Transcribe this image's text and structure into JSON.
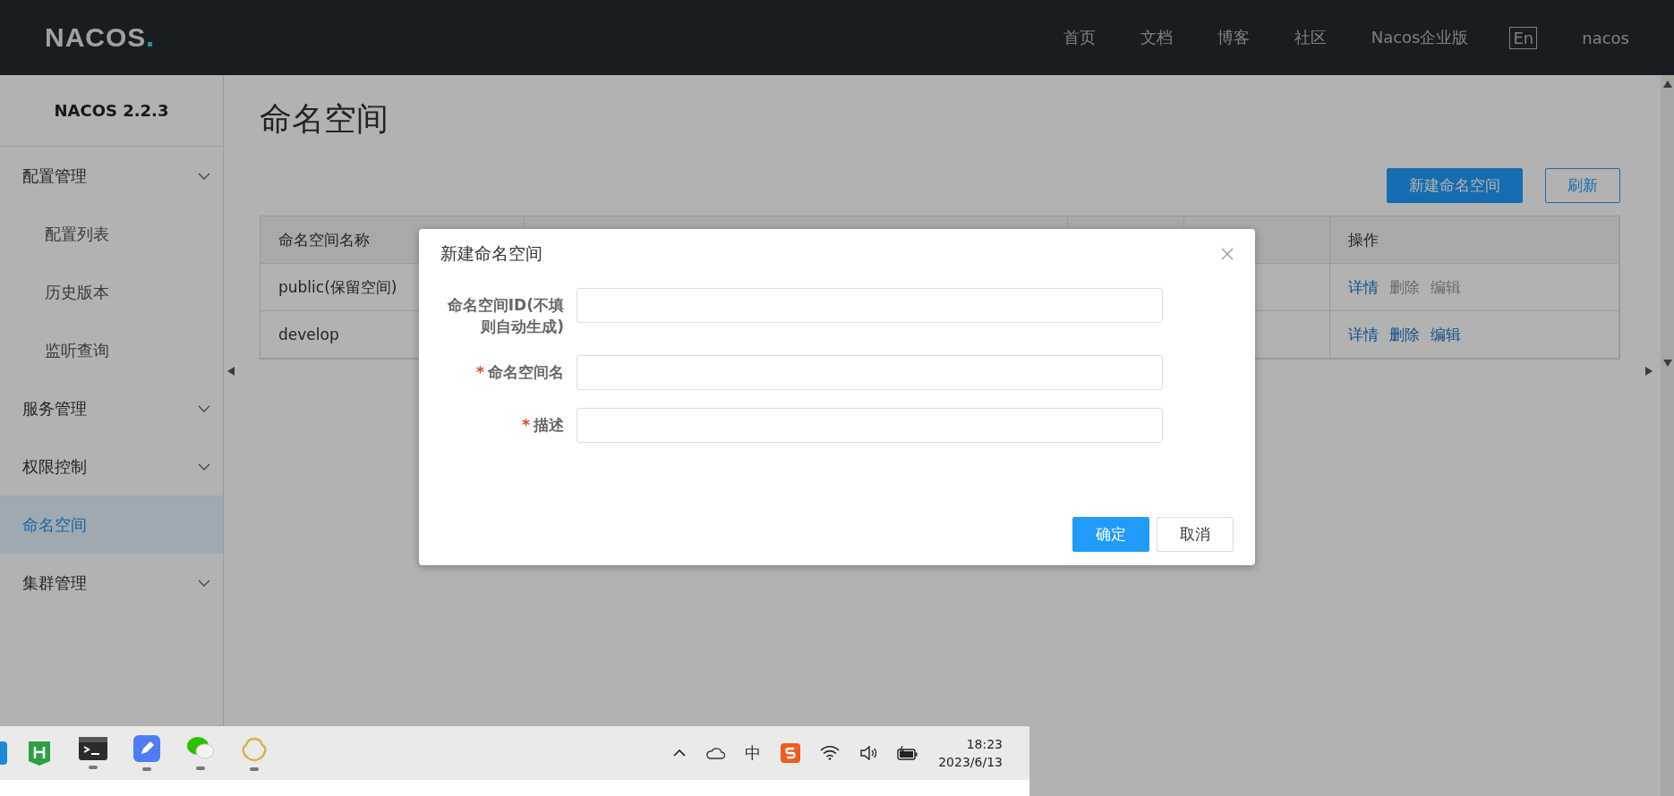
{
  "header": {
    "logo": "NACOS",
    "nav": [
      {
        "label": "首页",
        "kind": "link"
      },
      {
        "label": "文档",
        "kind": "link"
      },
      {
        "label": "博客",
        "kind": "link"
      },
      {
        "label": "社区",
        "kind": "link"
      },
      {
        "label": "Nacos企业版",
        "kind": "link"
      },
      {
        "label": "En",
        "kind": "boxed"
      },
      {
        "label": "nacos",
        "kind": "link"
      }
    ]
  },
  "sidebar": {
    "version": "NACOS 2.2.3",
    "items": [
      {
        "label": "配置管理",
        "kind": "group",
        "expanded": true,
        "selected": false,
        "children": [
          {
            "label": "配置列表",
            "selected": false
          },
          {
            "label": "历史版本",
            "selected": false
          },
          {
            "label": "监听查询",
            "selected": false
          }
        ]
      },
      {
        "label": "服务管理",
        "kind": "group",
        "selected": false
      },
      {
        "label": "权限控制",
        "kind": "group",
        "selected": false
      },
      {
        "label": "命名空间",
        "kind": "link",
        "selected": true
      },
      {
        "label": "集群管理",
        "kind": "group",
        "selected": false
      }
    ]
  },
  "page": {
    "title": "命名空间",
    "buttons": [
      {
        "label": "新建命名空间",
        "kind": "primary"
      },
      {
        "label": "刷新",
        "kind": "outline"
      }
    ]
  },
  "table": {
    "columns": [
      "命名空间名称",
      "操作"
    ],
    "rows": [
      {
        "name": "public(保留空间)",
        "actions": [
          {
            "label": "详情",
            "disabled": false
          },
          {
            "label": "删除",
            "disabled": true
          },
          {
            "label": "编辑",
            "disabled": true
          }
        ]
      },
      {
        "name": "develop",
        "actions": [
          {
            "label": "详情",
            "disabled": false
          },
          {
            "label": "删除",
            "disabled": false
          },
          {
            "label": "编辑",
            "disabled": false
          }
        ]
      }
    ]
  },
  "dialog": {
    "title": "新建命名空间",
    "required_mark": "*",
    "fields": [
      {
        "label": "命名空间ID(不填则自动生成)",
        "required": false
      },
      {
        "label": "命名空间名",
        "required": true
      },
      {
        "label": "描述",
        "required": true
      }
    ],
    "buttons": [
      {
        "label": "确定",
        "kind": "primary"
      },
      {
        "label": "取消",
        "kind": "default"
      }
    ]
  },
  "taskbar": {
    "ime": "中",
    "time": "18:23",
    "date": "2023/6/13"
  }
}
